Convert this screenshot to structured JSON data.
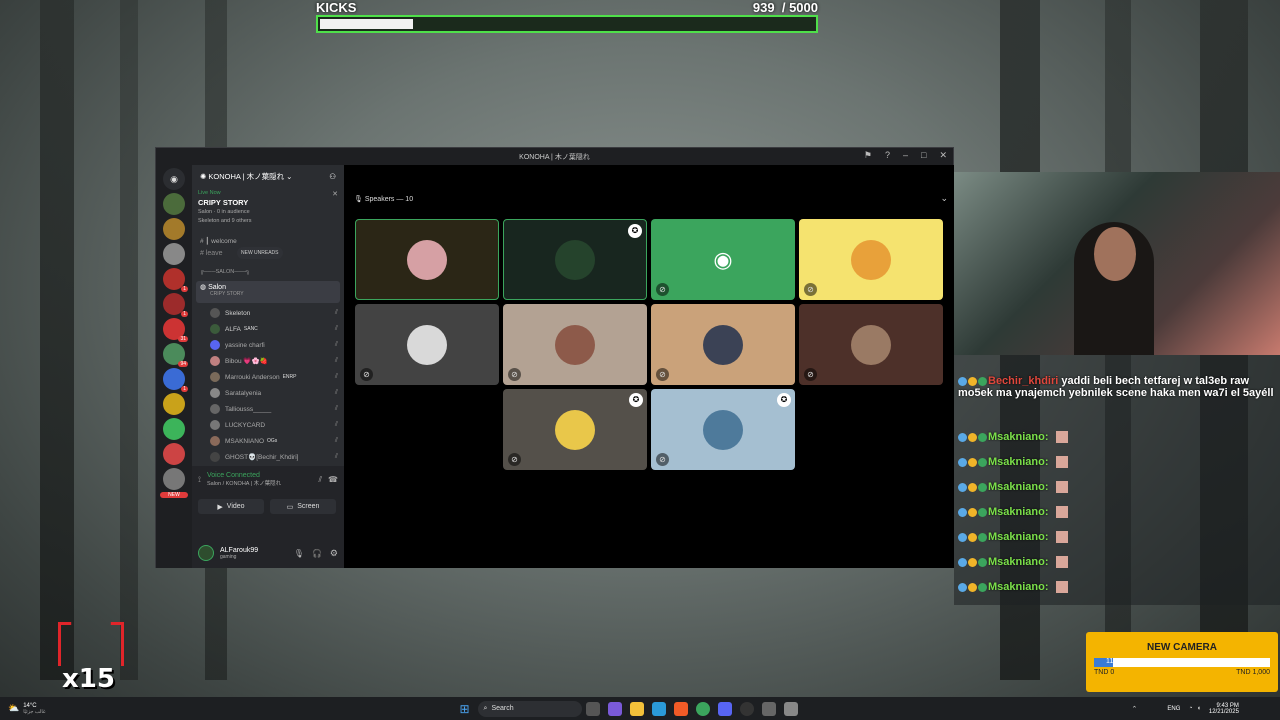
{
  "kicks": {
    "label": "KICKS",
    "current": "939",
    "goal": "/ 5000",
    "progress": 0.188
  },
  "discord": {
    "window_title": "KONOHA | 木ノ葉隠れ",
    "server_name": "KONOHA | 木ノ葉隠れ",
    "live": {
      "status": "Live Now",
      "title": "CRIPY STORY",
      "sub": "Salon · 0 in audience",
      "listeners": "Skeleton and 9 others"
    },
    "channels": {
      "welcome": "welcome",
      "leave": "leave",
      "new_unreads": "NEW UNREADS",
      "category": "╔───SALON───╗",
      "salon": "Salon",
      "salon_sub": "CRIPY STORY"
    },
    "members": [
      {
        "name": "Skeleton",
        "color": "#cfcfcf"
      },
      {
        "name": "ALFA",
        "tag": "SANC",
        "color": "#cfcfcf"
      },
      {
        "name": "yassine charfi",
        "color": "#aaaaaa"
      },
      {
        "name": "Bibou 💗🌸🍓",
        "color": "#aaaaaa"
      },
      {
        "name": "Marrouki Anderson",
        "tag": "ENRP",
        "color": "#aaaaaa"
      },
      {
        "name": "Saratalyenia",
        "color": "#aaaaaa"
      },
      {
        "name": "Talliousss_____",
        "color": "#aaaaaa"
      },
      {
        "name": "LUCKYCARD",
        "color": "#aaaaaa"
      },
      {
        "name": "MSAKNIANO",
        "tag": "OGs",
        "color": "#aaaaaa"
      },
      {
        "name": "GHOST💀[Bechir_Khdiri]",
        "color": "#aaaaaa"
      }
    ],
    "rail_badge": "NEW",
    "voice": {
      "status": "Voice Connected",
      "channel": "Salon / KONOHA | 木ノ葉隠れ",
      "video": "Video",
      "screen": "Screen"
    },
    "user": {
      "name": "ALFarouk99",
      "status": "gaming"
    },
    "stage": {
      "header": "Speakers — 10"
    }
  },
  "chat": {
    "messages": [
      {
        "user": "Bechir_khdiri",
        "user_color": "#e0473c",
        "text": "yaddi beli bech tetfarej w tal3eb raw mo5ek ma ynajemch yebnilek scene haka men wa7i el 5ayéll"
      },
      {
        "user": "Msakniano:",
        "user_color": "#7be04a",
        "text": ""
      },
      {
        "user": "Msakniano:",
        "user_color": "#7be04a",
        "text": ""
      },
      {
        "user": "Msakniano:",
        "user_color": "#7be04a",
        "text": ""
      },
      {
        "user": "Msakniano:",
        "user_color": "#7be04a",
        "text": ""
      },
      {
        "user": "Msakniano:",
        "user_color": "#7be04a",
        "text": ""
      },
      {
        "user": "Msakniano:",
        "user_color": "#7be04a",
        "text": ""
      },
      {
        "user": "Msakniano:",
        "user_color": "#7be04a",
        "text": ""
      }
    ]
  },
  "new_camera": {
    "title": "NEW CAMERA",
    "progress_label": "110",
    "min": "TND 0",
    "max": "TND 1,000",
    "progress": 0.11
  },
  "combo": "x15",
  "taskbar": {
    "weather": "14°C",
    "weather_sub": "غالب جزئيًا",
    "search": "Search",
    "lang": "ENG",
    "time": "9:43 PM",
    "date": "12/21/2025"
  }
}
